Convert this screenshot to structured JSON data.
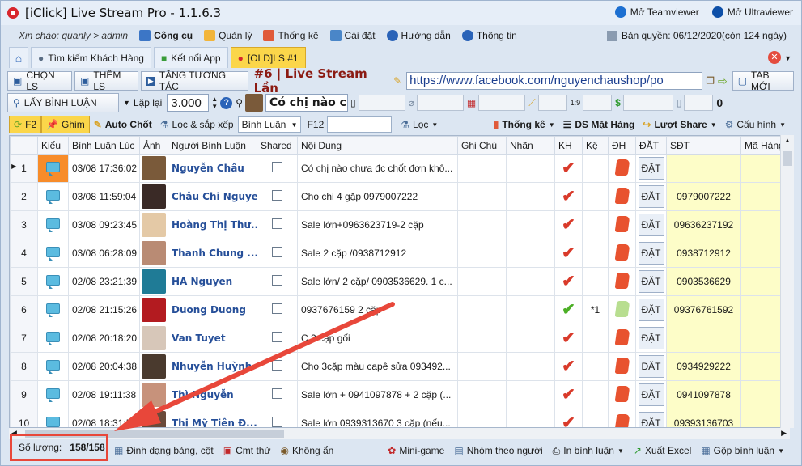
{
  "title": "[iClick] Live Stream Pro - 1.1.6.3",
  "title_links": [
    "Mở Teamviewer",
    "Mở Ultraviewer"
  ],
  "greeting": "Xin chào: quanly > admin",
  "menu": [
    "Công cụ",
    "Quản lý",
    "Thống kê",
    "Cài đặt",
    "Hướng dẫn",
    "Thông tin"
  ],
  "license": "Bản quyền: 06/12/2020(còn 124 ngày)",
  "tabs": [
    "Tìm kiếm Khách Hàng",
    "Kết nối App",
    "[OLD]LS #1"
  ],
  "row2": {
    "chon": "CHỌN LS",
    "them": "THÊM LS",
    "tang": "TĂNG TƯƠNG TÁC",
    "live": "#6 | Live Stream Lần",
    "url": "https://www.facebook.com/nguyenchaushop/po",
    "tabmoi": "TAB MỚI"
  },
  "row3": {
    "lay": "LẤY BÌNH LUẬN",
    "lap": "Lặp lại",
    "interval": "3.000",
    "comment": "Có chị nào c",
    "zero": "0"
  },
  "toolbar": {
    "f2": "F2",
    "ghim": "Ghim",
    "autochot": "Auto Chốt",
    "loc_sap": "Lọc & sắp xếp",
    "binhluan": "Bình Luận",
    "f12": "F12",
    "loc": "Lọc",
    "thongke": "Thống kê",
    "dsmathang": "DS Mặt Hàng",
    "luotshare": "Lượt Share",
    "cauhinh": "Cấu hình"
  },
  "columns": [
    "",
    "Kiểu",
    "Bình Luận Lúc",
    "Ảnh",
    "Người Bình Luận",
    "Shared",
    "Nội Dung",
    "Ghi Chú",
    "Nhãn",
    "KH",
    "Kệ",
    "ĐH",
    "ĐẶT",
    "SĐT",
    "Mã Hàng"
  ],
  "dat_label": "ĐẶT",
  "rows": [
    {
      "n": "1",
      "time": "03/08 17:36:02",
      "name": "Nguyễn Châu",
      "content": "Có chị nào chưa đc chốt đơn khô...",
      "ke": "",
      "sdt": "",
      "avatar": "#7a5a3a",
      "active": true,
      "green": false
    },
    {
      "n": "2",
      "time": "03/08 11:59:04",
      "name": "Châu Chi Nguyen",
      "content": "Cho chị 4 gặp 0979007222",
      "ke": "",
      "sdt": "0979007222",
      "avatar": "#3a2a26",
      "active": false,
      "green": false
    },
    {
      "n": "3",
      "time": "03/08 09:23:45",
      "name": "Hoàng Thị Thư...",
      "content": "Sale lớn+0963623719-2 cặp",
      "ke": "",
      "sdt": "09636237192",
      "avatar": "#e4c9a6",
      "active": false,
      "green": false
    },
    {
      "n": "4",
      "time": "03/08 06:28:09",
      "name": "Thanh Chung ...",
      "content": "Sale 2 cặp /0938712912",
      "ke": "",
      "sdt": "0938712912",
      "avatar": "#b98b74",
      "active": false,
      "green": false
    },
    {
      "n": "5",
      "time": "02/08 23:21:39",
      "name": "HA Nguyen",
      "content": "Sale lớn/ 2 cặp/ 0903536629. 1 c...",
      "ke": "",
      "sdt": "0903536629",
      "avatar": "#1f7b96",
      "active": false,
      "green": false
    },
    {
      "n": "6",
      "time": "02/08 21:15:26",
      "name": "Duong Duong",
      "content": "0937676159 2 cặp",
      "ke": "*1",
      "sdt": "09376761592",
      "avatar": "#b31b20",
      "active": false,
      "green": true
    },
    {
      "n": "7",
      "time": "02/08 20:18:20",
      "name": "Van Tuyet",
      "content": "C 2 cặp gối",
      "ke": "",
      "sdt": "",
      "avatar": "#d7c7b9",
      "active": false,
      "green": false
    },
    {
      "n": "8",
      "time": "02/08 20:04:38",
      "name": "Nhuyễn Huỳnh",
      "content": "Cho 3cặp màu capê sửa 093492...",
      "ke": "",
      "sdt": "0934929222",
      "avatar": "#4a3a2e",
      "active": false,
      "green": false
    },
    {
      "n": "9",
      "time": "02/08 19:11:38",
      "name": "Thì Nguyễn",
      "content": "Sale lớn + 0941097878 + 2 cặp (...",
      "ke": "",
      "sdt": "0941097878",
      "avatar": "#c7927b",
      "active": false,
      "green": false
    },
    {
      "n": "10",
      "time": "02/08 18:31:57",
      "name": "Thị Mỹ Tiên Đ...",
      "content": "Sale lớn 0939313670 3 cặp (nếu...",
      "ke": "",
      "sdt": "09393136703",
      "avatar": "#6a4a3a",
      "active": false,
      "green": false
    }
  ],
  "status": {
    "label": "Số lượng:",
    "count": "158/158",
    "items": [
      "Định dạng bảng, cột",
      "Cmt thử",
      "Không ẩn",
      "Mini-game",
      "Nhóm theo người",
      "In bình luận",
      "Xuất Excel",
      "Gộp bình luận"
    ]
  },
  "colors": {
    "accent_yellow": "#fbd64a",
    "red": "#e8473a",
    "link_blue": "#264f99"
  }
}
